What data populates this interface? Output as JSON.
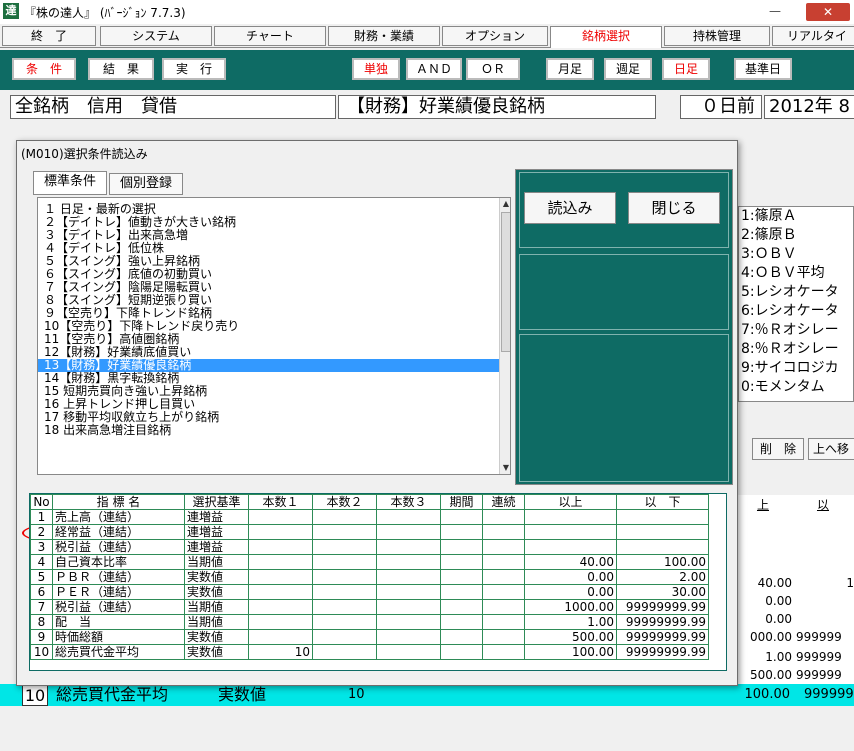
{
  "app": {
    "icon_char": "達",
    "title": "『株の達人』 (ﾊﾞｰｼﾞｮﾝ 7.7.3)"
  },
  "window_controls": {
    "minimize": "—",
    "close": "✕"
  },
  "menu": [
    "終　了",
    "システム",
    "チャート",
    "財務・業績",
    "オプション",
    "銘柄選択",
    "持株管理",
    "リアルタイ"
  ],
  "toolbar": {
    "condition": "条　件",
    "result": "結　果",
    "execute": "実　行",
    "single": "単独",
    "and": "ＡＮＤ",
    "or": "ＯＲ",
    "monthly": "月足",
    "weekly": "週足",
    "daily": "日足",
    "base_date": "基準日"
  },
  "status": {
    "market": "全銘柄　信用　貸借",
    "condition_name": "【財務】好業績優良銘柄",
    "days_ago": "０日前",
    "date": "2012年 8"
  },
  "bg_list": [
    "1:篠原Ａ",
    "2:篠原Ｂ",
    "3:ＯＢＶ",
    "4:ＯＢＶ平均",
    "5:レシオケータ",
    "6:レシオケータ",
    "7:％Ｒオシレー",
    "8:％Ｒオシレー",
    "9:サイコロジカ",
    "0:モメンタム"
  ],
  "bg_buttons": {
    "delete": "削　除",
    "move_up": "上へ移動"
  },
  "bg_headers": [
    "上",
    "以"
  ],
  "bg_values": [
    [
      "40.00",
      "1"
    ],
    [
      "0.00",
      ""
    ],
    [
      "0.00",
      ""
    ],
    [
      "000.00",
      "999999"
    ],
    [
      "1.00",
      "999999"
    ],
    [
      "500.00",
      "999999"
    ]
  ],
  "bg_bottom": {
    "no": "10",
    "name": "総売買代金平均",
    "criteria": "実数値",
    "count": "10",
    "min": "100.00",
    "max": "999999"
  },
  "dialog": {
    "title": "(M010)選択条件読込み",
    "tab_standard": "標準条件",
    "tab_custom": "個別登録",
    "load_button": "読込み",
    "close_button": "閉じる",
    "items": [
      "１ 日足・最新の選択",
      "２【デイトレ】値動きが大きい銘柄",
      "３【デイトレ】出来高急増",
      "４【デイトレ】低位株",
      "５【スイング】強い上昇銘柄",
      "６【スイング】底値の初動買い",
      "７【スイング】陰陽足陽転買い",
      "８【スイング】短期逆張り買い",
      "９【空売り】下降トレンド銘柄",
      "10【空売り】下降トレンド戻り売り",
      "11【空売り】高値圏銘柄",
      "12【財務】好業績底値買い",
      "13【財務】好業績優良銘柄",
      "14【財務】黒字転換銘柄",
      "15 短期売買向き強い上昇銘柄",
      "16 上昇トレンド押し目買い",
      "17 移動平均収斂立ち上がり銘柄",
      "18 出来高急増注目銘柄"
    ],
    "selected_index": 12,
    "grid_headers": [
      "No",
      "指 標 名",
      "選択基準",
      "本数１",
      "本数２",
      "本数３",
      "期間",
      "連続",
      "以上",
      "以　下"
    ],
    "grid_rows": [
      [
        "1",
        "売上高（連結）",
        "連増益",
        "",
        "",
        "",
        "",
        "",
        "",
        ""
      ],
      [
        "2",
        "経常益（連結）",
        "連増益",
        "",
        "",
        "",
        "",
        "",
        "",
        ""
      ],
      [
        "3",
        "税引益（連結）",
        "連増益",
        "",
        "",
        "",
        "",
        "",
        "",
        ""
      ],
      [
        "4",
        "自己資本比率",
        "当期値",
        "",
        "",
        "",
        "",
        "",
        "40.00",
        "100.00"
      ],
      [
        "5",
        "ＰＢＲ（連結）",
        "実数値",
        "",
        "",
        "",
        "",
        "",
        "0.00",
        "2.00"
      ],
      [
        "6",
        "ＰＥＲ（連結）",
        "実数値",
        "",
        "",
        "",
        "",
        "",
        "0.00",
        "30.00"
      ],
      [
        "7",
        "税引益（連結）",
        "当期値",
        "",
        "",
        "",
        "",
        "",
        "1000.00",
        "99999999.99"
      ],
      [
        "8",
        "配　当",
        "当期値",
        "",
        "",
        "",
        "",
        "",
        "1.00",
        "99999999.99"
      ],
      [
        "9",
        "時価総額",
        "実数値",
        "",
        "",
        "",
        "",
        "",
        "500.00",
        "99999999.99"
      ],
      [
        "10",
        "総売買代金平均",
        "実数値",
        "10",
        "",
        "",
        "",
        "",
        "100.00",
        "99999999.99"
      ]
    ]
  },
  "colors": {
    "teal": "#0e6b64",
    "selection": "#3399ff",
    "highlight_ellipse": "#ee0000",
    "bottom_row": "#00e6e6"
  }
}
